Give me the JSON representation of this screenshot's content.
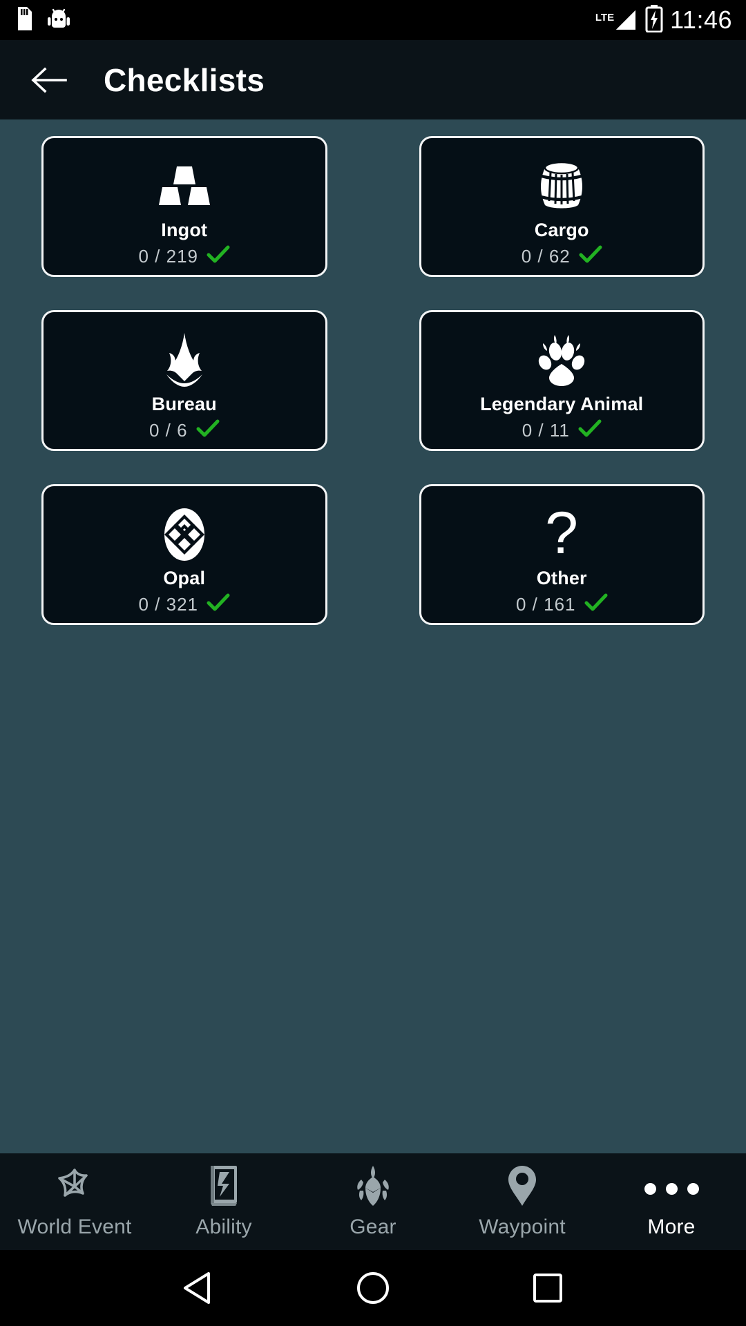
{
  "status_bar": {
    "icons_left": [
      "sd-card-icon",
      "android-debug-icon"
    ],
    "network_type": "LTE",
    "icons_right": [
      "signal-icon",
      "battery-charging-icon"
    ],
    "time": "11:46"
  },
  "app_bar": {
    "back_icon": "back-arrow-icon",
    "title": "Checklists"
  },
  "theme": {
    "background": "#2d4a54",
    "card_background": "#050f16",
    "card_border": "#f2f4f5",
    "bar_background": "#0b1318",
    "check_green": "#22b222",
    "label_inactive": "#9aa6ab",
    "label_active": "#ffffff"
  },
  "checklists": [
    {
      "icon": "ingot-icon",
      "title": "Ingot",
      "count": "0 / 219",
      "complete_icon": "check-icon"
    },
    {
      "icon": "barrel-icon",
      "title": "Cargo",
      "count": "0 / 62",
      "complete_icon": "check-icon"
    },
    {
      "icon": "assassin-insignia-icon",
      "title": "Bureau",
      "count": "0 / 6",
      "complete_icon": "check-icon"
    },
    {
      "icon": "paw-print-icon",
      "title": "Legendary Animal",
      "count": "0 / 11",
      "complete_icon": "check-icon"
    },
    {
      "icon": "opal-gem-icon",
      "title": "Opal",
      "count": "0 / 321",
      "complete_icon": "check-icon"
    },
    {
      "icon": "question-mark-icon",
      "title": "Other",
      "count": "0 / 161",
      "complete_icon": "check-icon"
    }
  ],
  "bottom_nav": [
    {
      "icon": "world-event-icon",
      "label": "World Event",
      "active": false
    },
    {
      "icon": "ability-book-icon",
      "label": "Ability",
      "active": false
    },
    {
      "icon": "gear-armor-icon",
      "label": "Gear",
      "active": false
    },
    {
      "icon": "map-pin-icon",
      "label": "Waypoint",
      "active": false
    },
    {
      "icon": "overflow-dots-icon",
      "label": "More",
      "active": true
    }
  ],
  "system_nav": {
    "back": "triangle-back-icon",
    "home": "circle-home-icon",
    "recents": "square-recents-icon"
  }
}
